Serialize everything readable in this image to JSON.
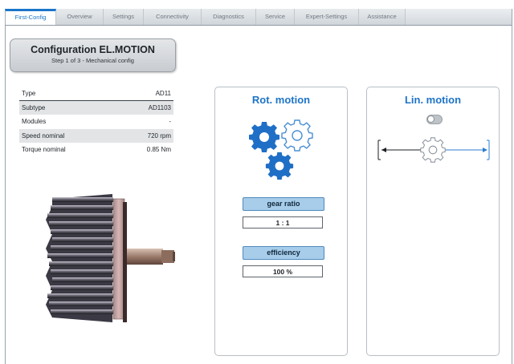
{
  "tabs": [
    {
      "label": "First-Config",
      "active": true
    },
    {
      "label": "Overview"
    },
    {
      "label": "Settings"
    },
    {
      "label": "Connectivity"
    },
    {
      "label": "Diagnostics"
    },
    {
      "label": "Service"
    },
    {
      "label": "Expert-Settings"
    },
    {
      "label": "Assistance"
    }
  ],
  "header": {
    "title": "Configuration EL.MOTION",
    "subtitle": "Step 1 of 3 - Mechanical config"
  },
  "properties": [
    {
      "label": "Type",
      "value": "AD11"
    },
    {
      "label": "Subtype",
      "value": "AD1103"
    },
    {
      "label": "Modules",
      "value": "-"
    },
    {
      "label": "Speed nominal",
      "value": "720 rpm"
    },
    {
      "label": "Torque nominal",
      "value": "0.85 Nm"
    }
  ],
  "rot_panel": {
    "title": "Rot. motion",
    "gear_ratio_label": "gear ratio",
    "gear_ratio_value": "1 : 1",
    "efficiency_label": "efficiency",
    "efficiency_value": "100 %",
    "icon": "gears-icon"
  },
  "lin_panel": {
    "title": "Lin. motion",
    "toggle_on": false,
    "icon": "linear-gear-icon"
  },
  "colors": {
    "accent": "#1d74c8",
    "button_fill": "#a7cdea"
  }
}
